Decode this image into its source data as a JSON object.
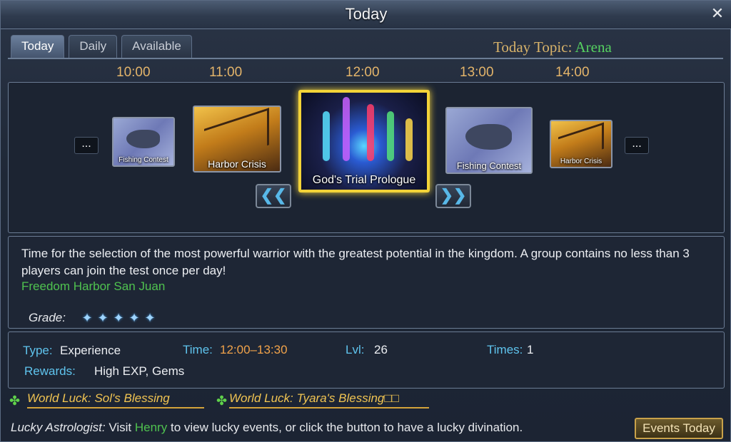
{
  "window": {
    "title": "Today"
  },
  "tabs": [
    {
      "label": "Today"
    },
    {
      "label": "Daily"
    },
    {
      "label": "Available"
    }
  ],
  "topic": {
    "label": "Today Topic:",
    "value": "Arena"
  },
  "times": [
    "10:00",
    "11:00",
    "12:00",
    "13:00",
    "14:00"
  ],
  "carousel": {
    "more_left": "...",
    "more_right": "...",
    "prev_glyph": "❮❮",
    "next_glyph": "❯❯",
    "cards": [
      {
        "label": "Fishing Contest"
      },
      {
        "label": "Harbor Crisis"
      },
      {
        "label": "God's Trial Prologue"
      },
      {
        "label": "Fishing Contest"
      },
      {
        "label": "Harbor Crisis"
      }
    ]
  },
  "description": {
    "text": "Time for the selection of the most powerful warrior with the greatest potential in the kingdom. A group contains no less than 3 players can join the test once per day!",
    "location": "Freedom Harbor San Juan",
    "grade_label": "Grade:",
    "grade_stars": 5
  },
  "details": {
    "type_label": "Type:",
    "type_value": "Experience",
    "time_label": "Time:",
    "time_value": "12:00–13:30",
    "lvl_label": "Lvl:",
    "lvl_value": "26",
    "times_label": "Times:",
    "times_value": "1",
    "rewards_label": "Rewards:",
    "rewards_value": "High EXP, Gems"
  },
  "luck": [
    {
      "text": "World Luck: Sol's Blessing"
    },
    {
      "text": "World Luck: Tyara's Blessing□□"
    }
  ],
  "footer": {
    "label": "Lucky Astrologist:",
    "pre": "Visit",
    "npc": "Henry",
    "post": "to view lucky events, or click the button to have a lucky divination.",
    "button": "Events Today"
  },
  "colors": {
    "accent_gold": "#d8b36a",
    "green": "#4fc24f",
    "blue_label": "#5fc4ee",
    "orange_time": "#f0a24a",
    "selected_border": "#f3d338"
  }
}
